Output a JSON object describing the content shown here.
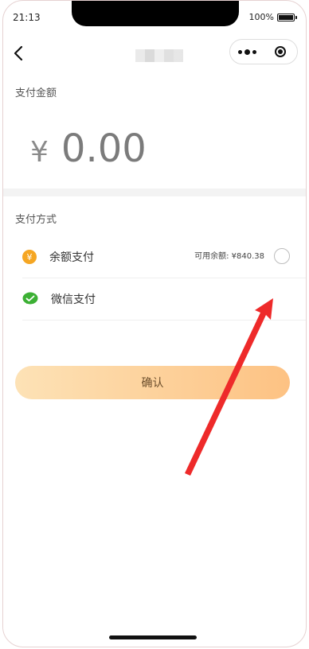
{
  "status_bar": {
    "time": "21:13",
    "battery": "100%"
  },
  "payment": {
    "amount_label": "支付金额",
    "currency_symbol": "¥",
    "amount": "0.00",
    "method_label": "支付方式",
    "methods": [
      {
        "label": "余额支付",
        "icon_symbol": "¥",
        "balance_text": "可用余额: ¥840.38"
      },
      {
        "label": "微信支付"
      }
    ]
  },
  "confirm_label": "确认",
  "colors": {
    "accent_start": "#fde2b6",
    "accent_end": "#fdc283",
    "annotation": "#ee2a2a",
    "coin": "#f5a623",
    "wechat": "#3cb034"
  },
  "icons": [
    "back-arrow-icon",
    "more-dots-icon",
    "target-close-icon",
    "balance-coin-icon",
    "wechat-icon",
    "battery-icon"
  ]
}
